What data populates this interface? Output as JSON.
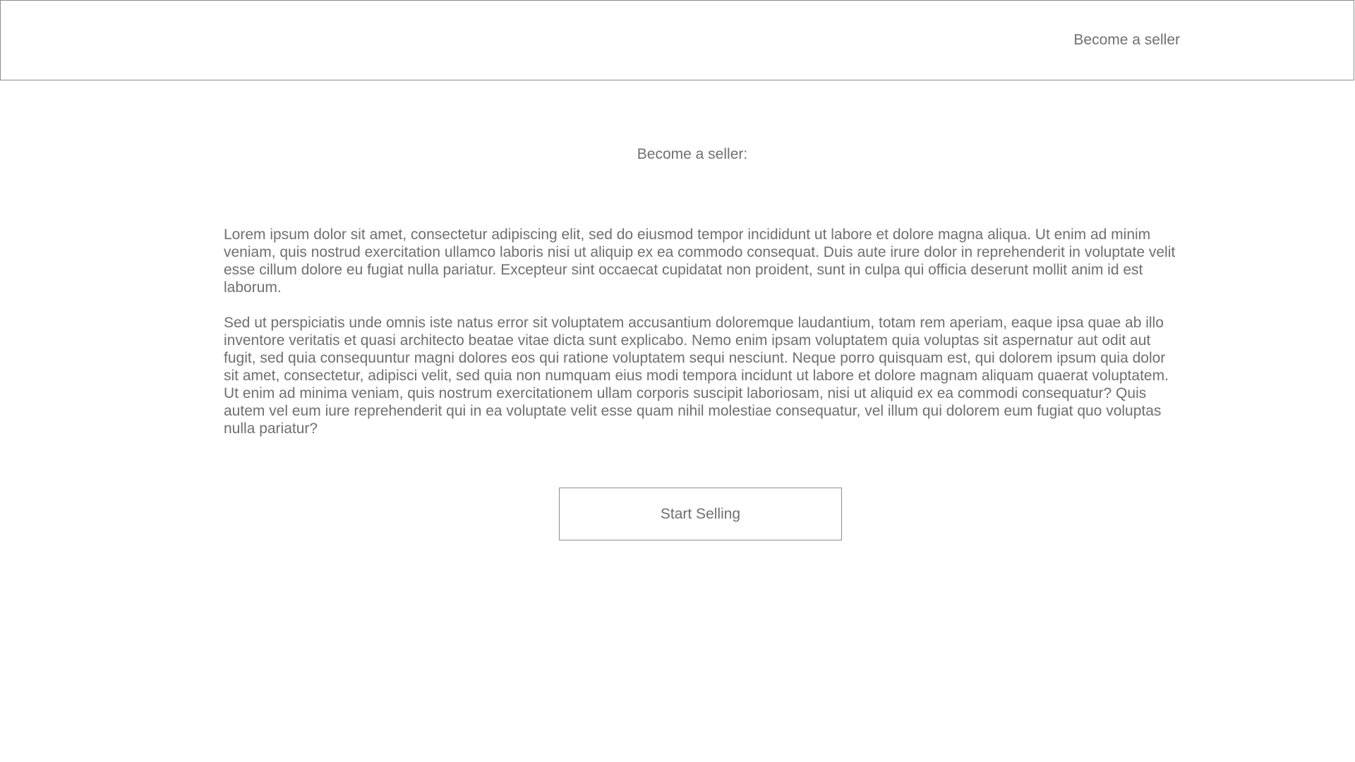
{
  "header": {
    "become_seller_link": "Become a seller"
  },
  "main": {
    "heading": "Become a seller:",
    "paragraphs": [
      "Lorem ipsum dolor sit amet, consectetur adipiscing elit, sed do eiusmod tempor incididunt ut labore et dolore magna aliqua. Ut enim ad minim veniam, quis nostrud exercitation ullamco laboris nisi ut aliquip ex ea commodo consequat. Duis aute irure dolor in reprehenderit in voluptate velit esse cillum dolore eu fugiat nulla pariatur. Excepteur sint occaecat cupidatat non proident, sunt in culpa qui officia deserunt mollit anim id est laborum.",
      "Sed ut perspiciatis unde omnis iste natus error sit voluptatem accusantium doloremque laudantium, totam rem aperiam, eaque ipsa quae ab illo inventore veritatis et quasi architecto beatae vitae dicta sunt explicabo. Nemo enim ipsam voluptatem quia voluptas sit aspernatur aut odit aut fugit, sed quia consequuntur magni dolores eos qui ratione voluptatem sequi nesciunt. Neque porro quisquam est, qui dolorem ipsum quia dolor sit amet, consectetur, adipisci velit, sed quia non numquam eius modi tempora incidunt ut labore et dolore magnam aliquam quaerat voluptatem. Ut enim ad minima veniam, quis nostrum exercitationem ullam corporis suscipit laboriosam, nisi ut aliquid ex ea commodi consequatur? Quis autem vel eum iure reprehenderit qui in ea voluptate velit esse quam nihil molestiae consequatur, vel illum qui dolorem eum fugiat quo voluptas nulla pariatur?"
    ],
    "start_selling_button": "Start Selling"
  },
  "colors": {
    "text": "#6f6f6f",
    "border": "#8c8c8c",
    "background": "#ffffff"
  }
}
